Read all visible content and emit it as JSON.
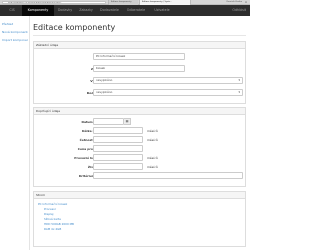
{
  "browser": {
    "url": "http://localhost/CIS-System/public/komponenty/edit/1",
    "tab_inactive": "Editace komponenty",
    "tab_active": "Editace komponenty | Syste...",
    "brand": "Dominik Kostka",
    "close": "×"
  },
  "navbar": {
    "items": [
      "CIS",
      "Komponenty",
      "Dodavky",
      "Zakazky",
      "Dodavatele",
      "Odberatele",
      "Uzivatele"
    ],
    "right": "Odhlásit"
  },
  "sidebar": {
    "items": [
      "Přehled",
      "Nová komponenta",
      "Import komponent"
    ]
  },
  "page": {
    "title": "Editace komponenty"
  },
  "panel1": {
    "heading": "Základní údaje",
    "fields": [
      {
        "label": "Název",
        "value": "PC Informační kiosek"
      },
      {
        "label": "Zkratka",
        "value": "Kiosek"
      },
      {
        "label": "Výrobce",
        "value": "nevyplněno"
      },
      {
        "label": "Dodavatel",
        "value": "nevyplněno"
      }
    ],
    "caret": "▾"
  },
  "panel2": {
    "heading": "Doplňující údaje",
    "fields": [
      {
        "label": "Datum revize",
        "value": ""
      },
      {
        "label": "Délka záruky",
        "value": "",
        "suffix": "měsíců"
      },
      {
        "label": "Četnost revize",
        "value": "",
        "suffix": "měsíců"
      },
      {
        "label": "Cena pro servis",
        "value": ""
      },
      {
        "label": "Provozní hodnota",
        "value": "",
        "suffix": "měsíců"
      },
      {
        "label": "Životnost",
        "value": "",
        "suffix": "měsíců"
      },
      {
        "label": "Kritérium kusu",
        "value": ""
      }
    ],
    "calendar_glyph": "▦"
  },
  "panel3": {
    "heading": "Strom",
    "root": "PC Informační kiosek",
    "children": [
      "Procesor",
      "Displej",
      "Síťová karta",
      "HDD 500GB 2000 MB",
      "RAM 4x 4GB"
    ]
  }
}
